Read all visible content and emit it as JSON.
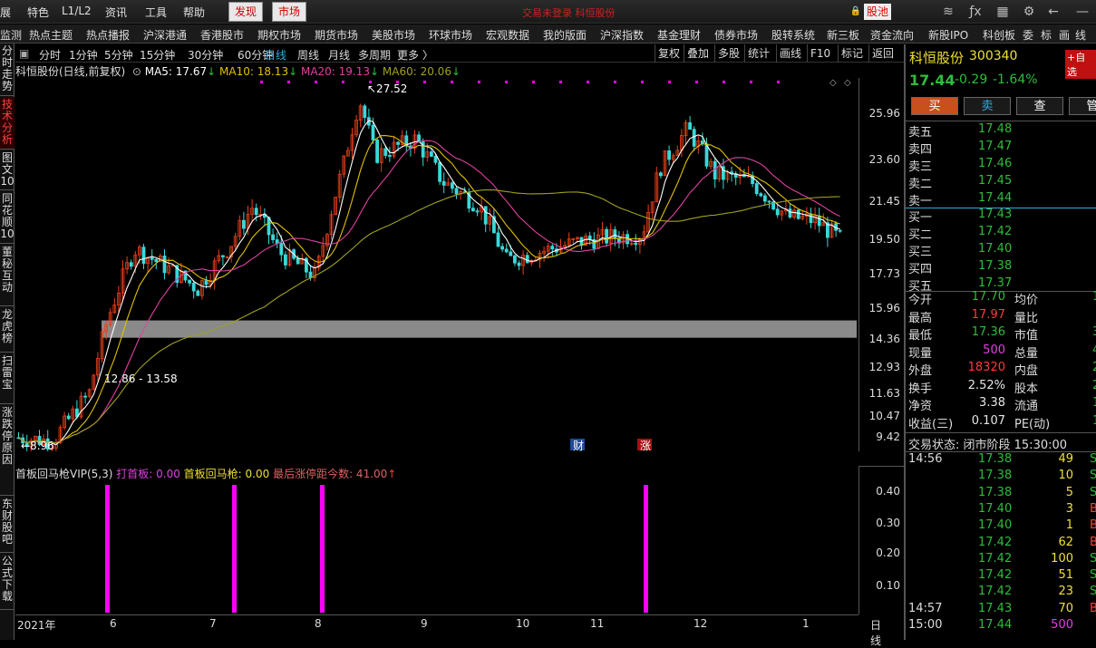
{
  "topbar": {
    "items": [
      "展",
      "特色",
      "L1/L2",
      "资讯",
      "工具",
      "帮助",
      "发现",
      "市场"
    ],
    "ticker": "交易未登录 科恒股份",
    "pool": "股池"
  },
  "navbar": {
    "items": [
      "监测",
      "热点主题",
      "热点播报",
      "沪深港通",
      "香港股市",
      "期权市场",
      "期货市场",
      "美股市场",
      "环球市场",
      "宏观数据",
      "我的版面",
      "沪深指数",
      "基金理财",
      "债券市场",
      "股转系统",
      "新三板",
      "资金流向",
      "新股IPO",
      "科创板",
      "委",
      "标",
      "画",
      "线"
    ]
  },
  "lefttabs": [
    "分时走势",
    "技术分析",
    "图文10",
    "同花顺10",
    "董秘互动",
    "龙虎榜",
    "扫雷宝",
    "涨跌停原因",
    "东财股吧",
    "公式下载"
  ],
  "periods": [
    "分时",
    "1分钟",
    "5分钟",
    "15分钟",
    "30分钟",
    "60分钟",
    "日线",
    "周线",
    "月线",
    "多周期",
    "更多"
  ],
  "rightbtns": [
    "复权",
    "叠加",
    "多股",
    "统计",
    "画线",
    "F10",
    "标记",
    "返回"
  ],
  "legend": {
    "name": "科恒股份(日线,前复权)",
    "ma5": "MA5: 17.67",
    "ma10": "MA10: 18.13",
    "ma20": "MA20: 19.13",
    "ma60": "MA60: 20.06"
  },
  "price_axis": [
    "25.96",
    "23.60",
    "21.45",
    "19.50",
    "17.73",
    "15.96",
    "14.36",
    "12.93",
    "11.63",
    "10.47",
    "9.42"
  ],
  "annot": {
    "high": "27.52",
    "low": "8.96",
    "zone": "12.86 - 13.58",
    "cai": "财",
    "zhang": "涨"
  },
  "indicator": {
    "name": "首板回马枪VIP(5,3)",
    "a": "打首板: 0.00",
    "b": "首板回马枪: 0.00",
    "c": "最后涨停距今数: 41.00",
    "axis": [
      "0.40",
      "0.30",
      "0.20",
      "0.10"
    ]
  },
  "dates": [
    "2021年",
    "6",
    "7",
    "8",
    "9",
    "10",
    "11",
    "12",
    "1"
  ],
  "period_label": "日线",
  "colors": {
    "up": "#e8401a",
    "down": "#3ad8d8",
    "ma5": "#ffffff",
    "ma10": "#e0c000",
    "ma20": "#e040a0",
    "ma60": "#a0a020",
    "signal": "#ff00ff"
  },
  "quote": {
    "name": "科恒股份",
    "code": "300340",
    "price": "17.44",
    "change": "-0.29",
    "pct": "-1.64%",
    "tag": "+自选",
    "buttons": [
      "买",
      "卖",
      "查",
      "管"
    ],
    "sell": [
      {
        "l": "卖五",
        "p": "17.48"
      },
      {
        "l": "卖四",
        "p": "17.47"
      },
      {
        "l": "卖三",
        "p": "17.46"
      },
      {
        "l": "卖二",
        "p": "17.45"
      },
      {
        "l": "卖一",
        "p": "17.44"
      }
    ],
    "buy": [
      {
        "l": "买一",
        "p": "17.43"
      },
      {
        "l": "买二",
        "p": "17.42"
      },
      {
        "l": "买三",
        "p": "17.40"
      },
      {
        "l": "买四",
        "p": "17.38"
      },
      {
        "l": "买五",
        "p": "17.37"
      }
    ],
    "stats": [
      {
        "a": "今开",
        "b": "17.70",
        "c": "均价",
        "d": "1"
      },
      {
        "a": "最高",
        "b": "17.97",
        "c": "量比",
        "d": ""
      },
      {
        "a": "最低",
        "b": "17.36",
        "c": "市值",
        "d": "3"
      },
      {
        "a": "现量",
        "b": "500",
        "c": "总量",
        "d": "4"
      },
      {
        "a": "外盘",
        "b": "18320",
        "c": "内盘",
        "d": "2"
      },
      {
        "a": "换手",
        "b": "2.52%",
        "c": "股本",
        "d": "2"
      },
      {
        "a": "净资",
        "b": "3.38",
        "c": "流通",
        "d": "1."
      },
      {
        "a": "收益(三)",
        "b": "0.107",
        "c": "PE(动)",
        "d": "1"
      }
    ],
    "status": "交易状态: 闭市阶段 15:30:00",
    "ticks": [
      {
        "t": "14:56",
        "p": "17.38",
        "v": "49",
        "s": "S"
      },
      {
        "t": "",
        "p": "17.38",
        "v": "10",
        "s": "S"
      },
      {
        "t": "",
        "p": "17.38",
        "v": "5",
        "s": "S"
      },
      {
        "t": "",
        "p": "17.40",
        "v": "3",
        "s": "B"
      },
      {
        "t": "",
        "p": "17.40",
        "v": "1",
        "s": "B"
      },
      {
        "t": "",
        "p": "17.42",
        "v": "62",
        "s": "B"
      },
      {
        "t": "",
        "p": "17.42",
        "v": "100",
        "s": "S"
      },
      {
        "t": "",
        "p": "17.42",
        "v": "51",
        "s": "S"
      },
      {
        "t": "",
        "p": "17.42",
        "v": "23",
        "s": "S"
      },
      {
        "t": "14:57",
        "p": "17.43",
        "v": "70",
        "s": "B"
      },
      {
        "t": "15:00",
        "p": "17.44",
        "v": "500",
        "s": ""
      }
    ]
  }
}
